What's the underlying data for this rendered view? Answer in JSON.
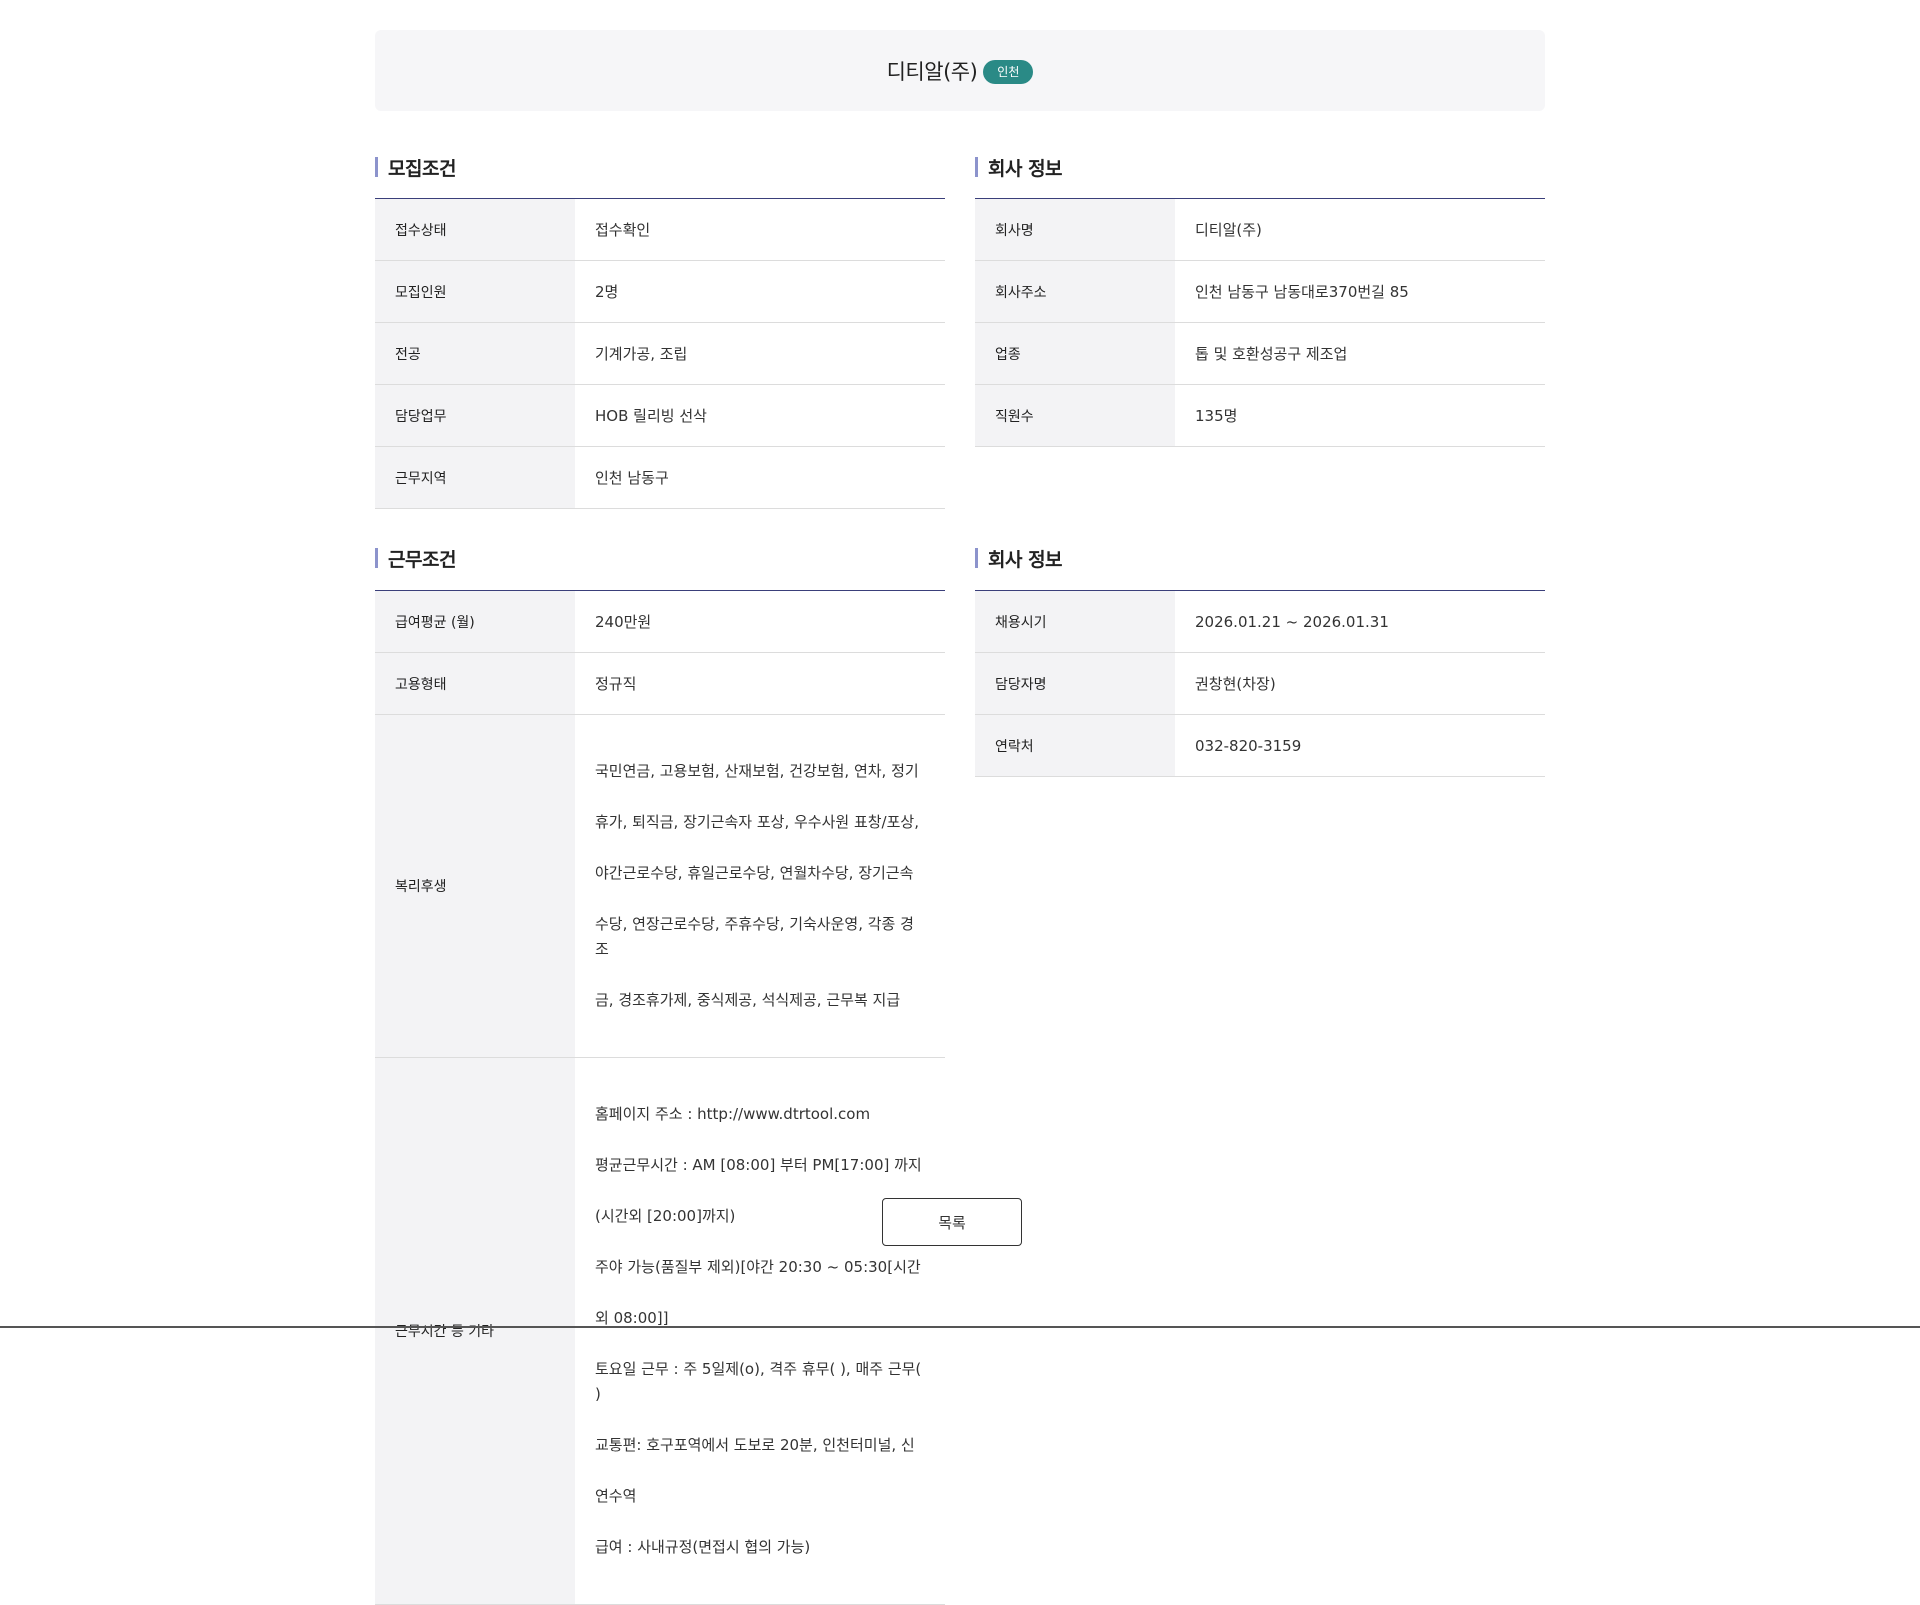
{
  "header": {
    "company": "디티알(주)",
    "region": "인천"
  },
  "recruit": {
    "title": "모집조건",
    "rows": [
      {
        "k": "접수상태",
        "v": "접수확인"
      },
      {
        "k": "모집인원",
        "v": "2명"
      },
      {
        "k": "전공",
        "v": "기계가공, 조립"
      },
      {
        "k": "담당업무",
        "v": "HOB 릴리빙 선삭"
      },
      {
        "k": "근무지역",
        "v": "인천 남동구"
      }
    ]
  },
  "company_info": {
    "title": "회사 정보",
    "rows": [
      {
        "k": "회사명",
        "v": "디티알(주)"
      },
      {
        "k": "회사주소",
        "v": "인천 남동구 남동대로370번길 85"
      },
      {
        "k": "업종",
        "v": "톱 및 호환성공구 제조업"
      },
      {
        "k": "직원수",
        "v": "135명"
      }
    ]
  },
  "work": {
    "title": "근무조건",
    "rows": [
      {
        "k": "급여평균 (월)",
        "v": "240만원"
      },
      {
        "k": "고용형태",
        "v": "정규직"
      }
    ],
    "welfare": {
      "k": "복리후생",
      "lines": [
        "국민연금, 고용보험, 산재보험, 건강보험, 연차, 정기",
        "휴가, 퇴직금, 장기근속자 포상, 우수사원 표창/포상,",
        "야간근로수당, 휴일근로수당, 연월차수당, 장기근속",
        "수당, 연장근로수당, 주휴수당, 기숙사운영, 각종 경조",
        "금, 경조휴가제, 중식제공, 석식제공, 근무복 지급"
      ]
    },
    "other": {
      "k": "근무시간 등 기타",
      "lines": [
        "홈페이지 주소 : http://www.dtrtool.com",
        "평균근무시간 : AM [08:00] 부터 PM[17:00] 까지",
        "(시간외 [20:00]까지)",
        "주야 가능(품질부 제외)[야간 20:30 ~ 05:30[시간",
        "외 08:00]]",
        "토요일 근무 : 주 5일제(o), 격주 휴무( ), 매주 근무( )",
        "교통편: 호구포역에서 도보로 20분, 인천터미널, 신",
        "연수역",
        "급여 : 사내규정(면접시 협의 가능)"
      ]
    }
  },
  "hiring_info": {
    "title": "회사 정보",
    "rows": [
      {
        "k": "채용시기",
        "v": "2026.01.21 ~ 2026.01.31"
      },
      {
        "k": "담당자명",
        "v": "권창현(차장)"
      },
      {
        "k": "연락처",
        "v": "032-820-3159"
      }
    ]
  },
  "list_button": "목록"
}
